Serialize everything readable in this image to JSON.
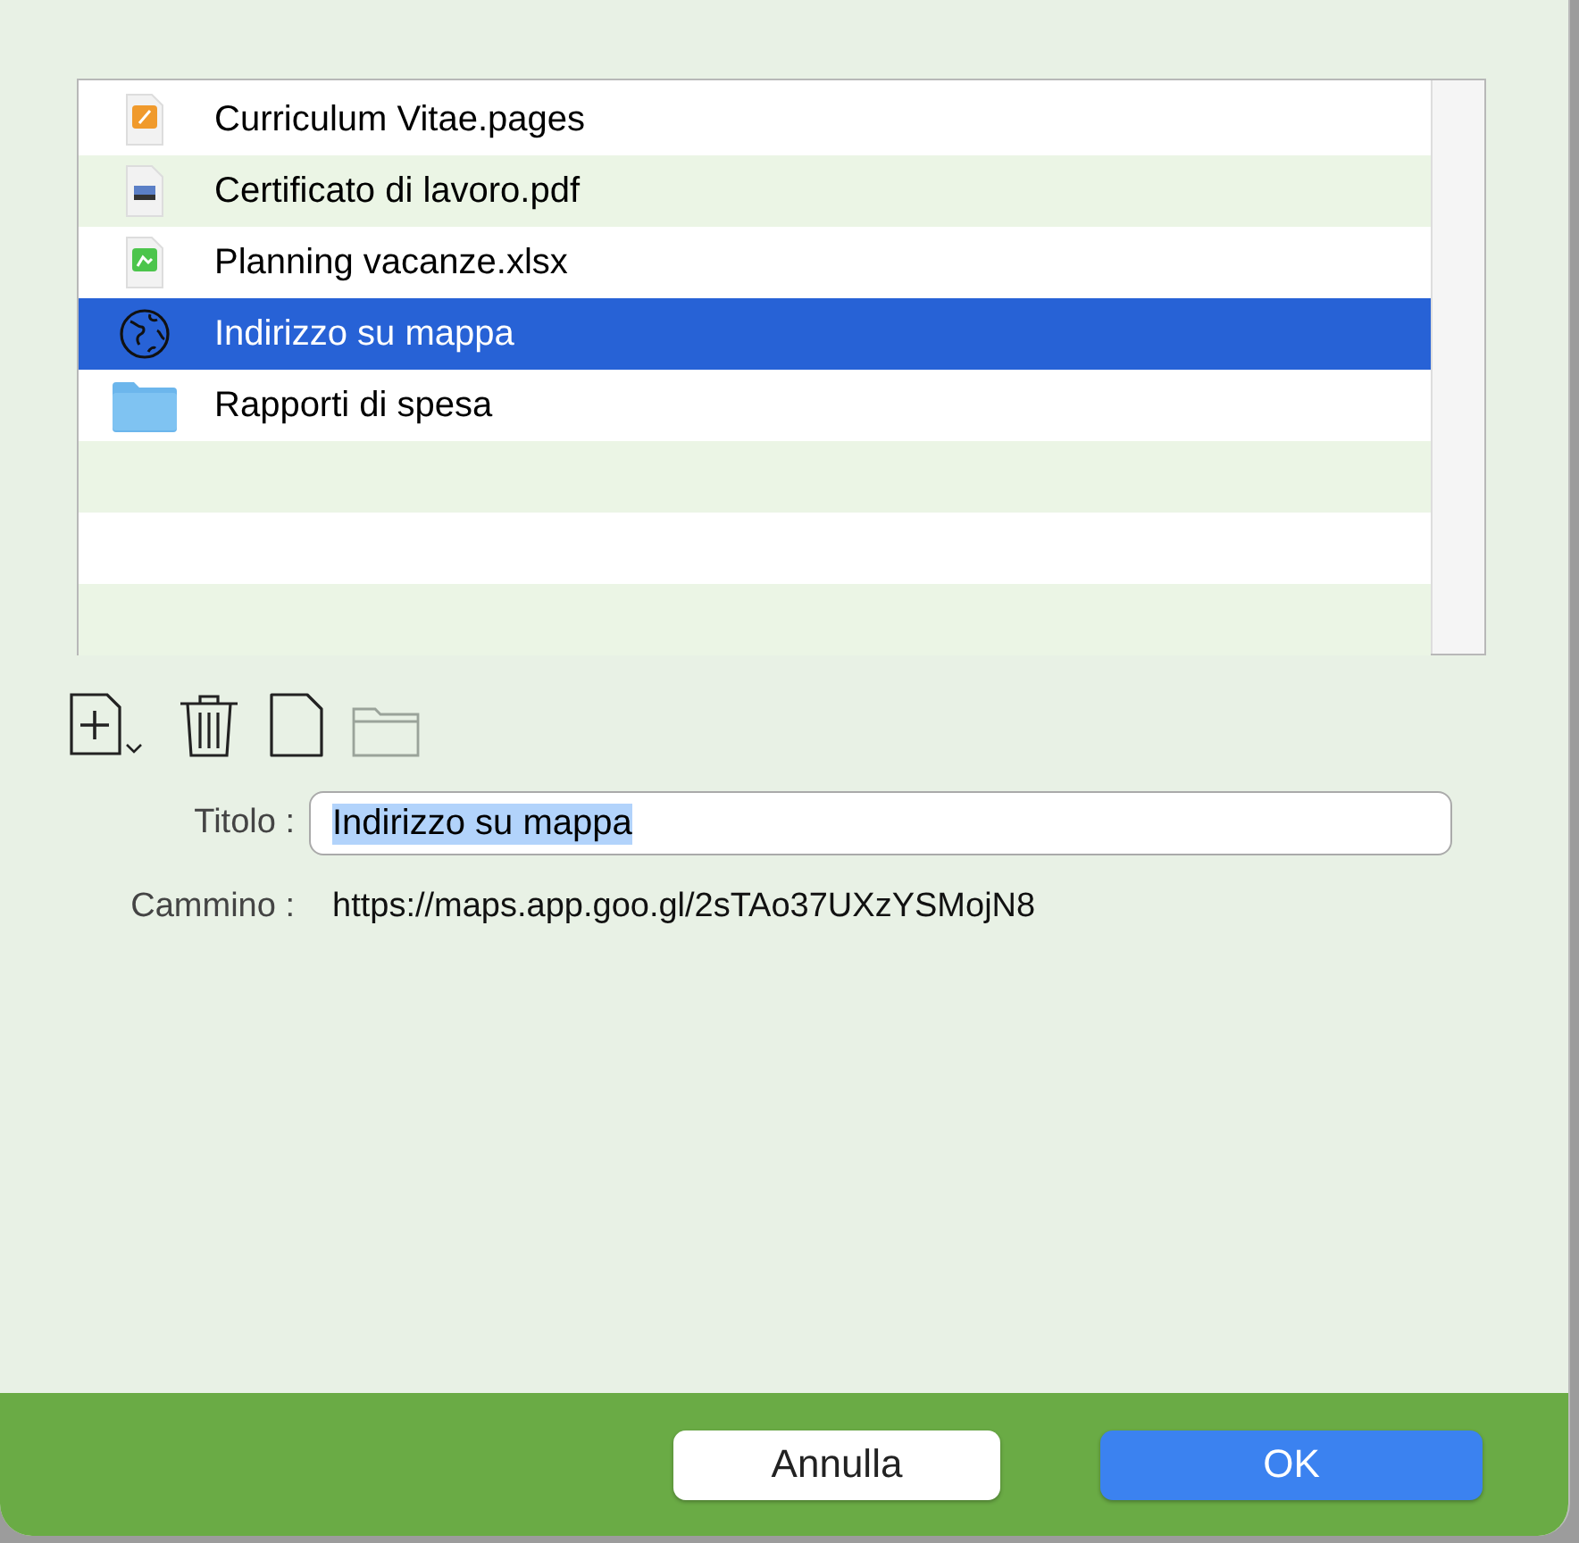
{
  "files": [
    {
      "name": "Curriculum Vitae.pages",
      "kind": "pages",
      "selected": false
    },
    {
      "name": "Certificato di lavoro.pdf",
      "kind": "pdf",
      "selected": false
    },
    {
      "name": "Planning vacanze.xlsx",
      "kind": "xlsx",
      "selected": false
    },
    {
      "name": "Indirizzo su mappa",
      "kind": "web",
      "selected": true
    },
    {
      "name": "Rapporti di spesa",
      "kind": "folder",
      "selected": false
    }
  ],
  "toolbar": [
    {
      "kind": "add",
      "disabled": false
    },
    {
      "kind": "trash",
      "disabled": false
    },
    {
      "kind": "file",
      "disabled": false
    },
    {
      "kind": "folder",
      "disabled": true
    }
  ],
  "title_field": {
    "label": "Titolo :",
    "value": "Indirizzo su mappa",
    "text_selected": true
  },
  "path": {
    "label": "Cammino :",
    "value": "https://maps.app.goo.gl/2sTAo37UXzYSMojN8"
  },
  "buttons": [
    {
      "label": "Annulla",
      "kind": "cancel"
    },
    {
      "label": "OK",
      "kind": "default"
    }
  ]
}
